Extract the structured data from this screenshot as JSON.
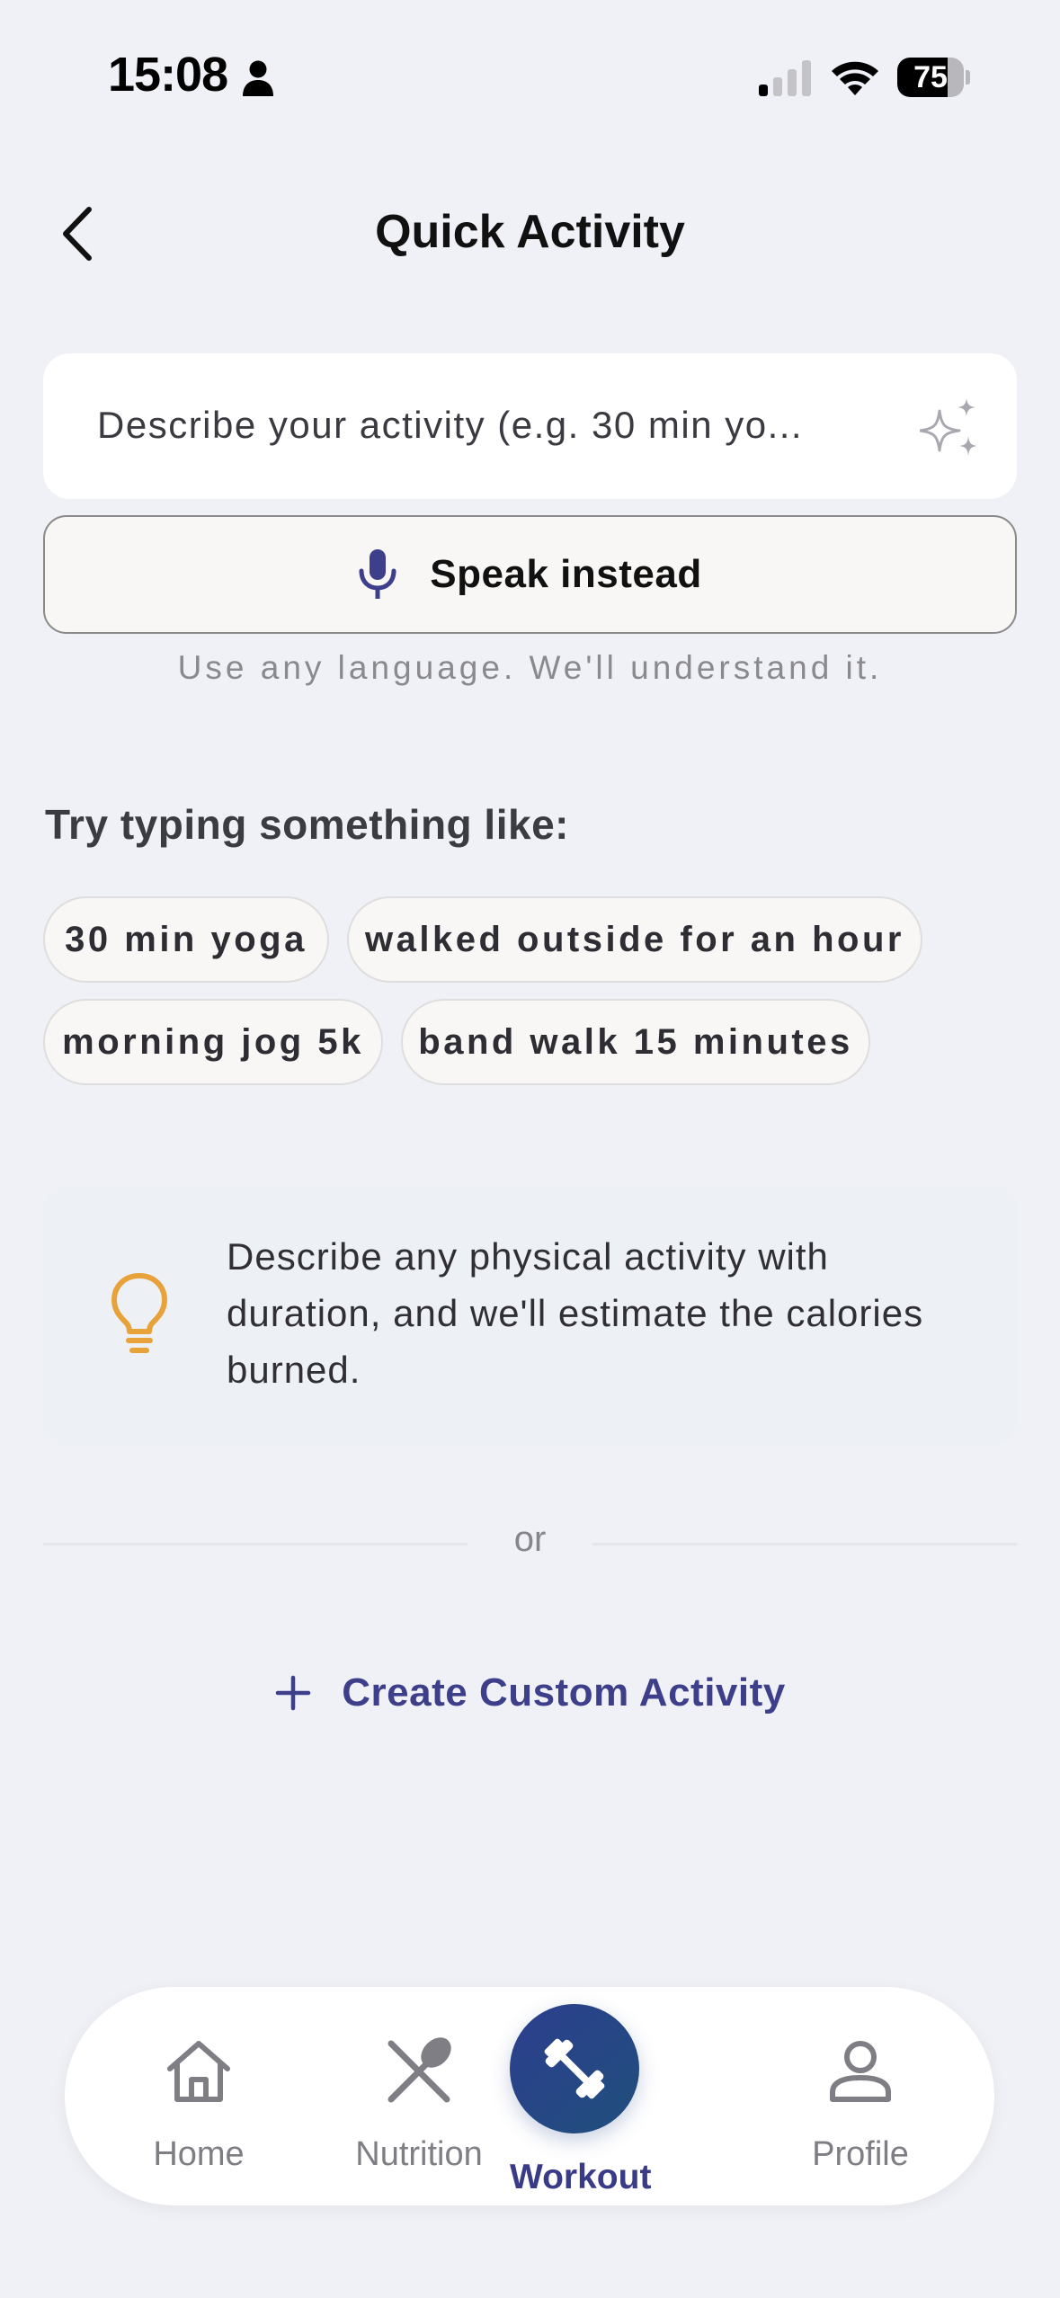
{
  "status_bar": {
    "time": "15:08",
    "battery": "75",
    "battery_level": 0.75
  },
  "header": {
    "title": "Quick Activity"
  },
  "input": {
    "placeholder": "Describe your activity (e.g. 30 min yo..."
  },
  "speak_button": {
    "label": "Speak instead"
  },
  "helper_text": "Use any language. We'll understand it.",
  "suggestions": {
    "heading": "Try typing something like:",
    "chips": [
      "30 min yoga",
      "walked outside for an hour",
      "morning jog 5k",
      "band walk 15 minutes"
    ]
  },
  "tip": {
    "text": "Describe any physical activity with duration, and we'll estimate the calories burned."
  },
  "divider": {
    "text": "or"
  },
  "create_custom": {
    "label": "Create Custom Activity"
  },
  "tab_bar": {
    "items": [
      {
        "label": "Home",
        "icon": "home-icon"
      },
      {
        "label": "Nutrition",
        "icon": "fork-spoon-icon"
      },
      {
        "label": "Workout",
        "icon": "dumbbell-icon",
        "active": true
      },
      {
        "label": "Profile",
        "icon": "person-icon"
      }
    ]
  },
  "colors": {
    "background": "#f0f1f6",
    "accent": "#3d3f8a",
    "tip_bulb": "#e8a23a",
    "workout_gradient_start": "#2d3e8e",
    "workout_gradient_end": "#1f4f7c"
  }
}
